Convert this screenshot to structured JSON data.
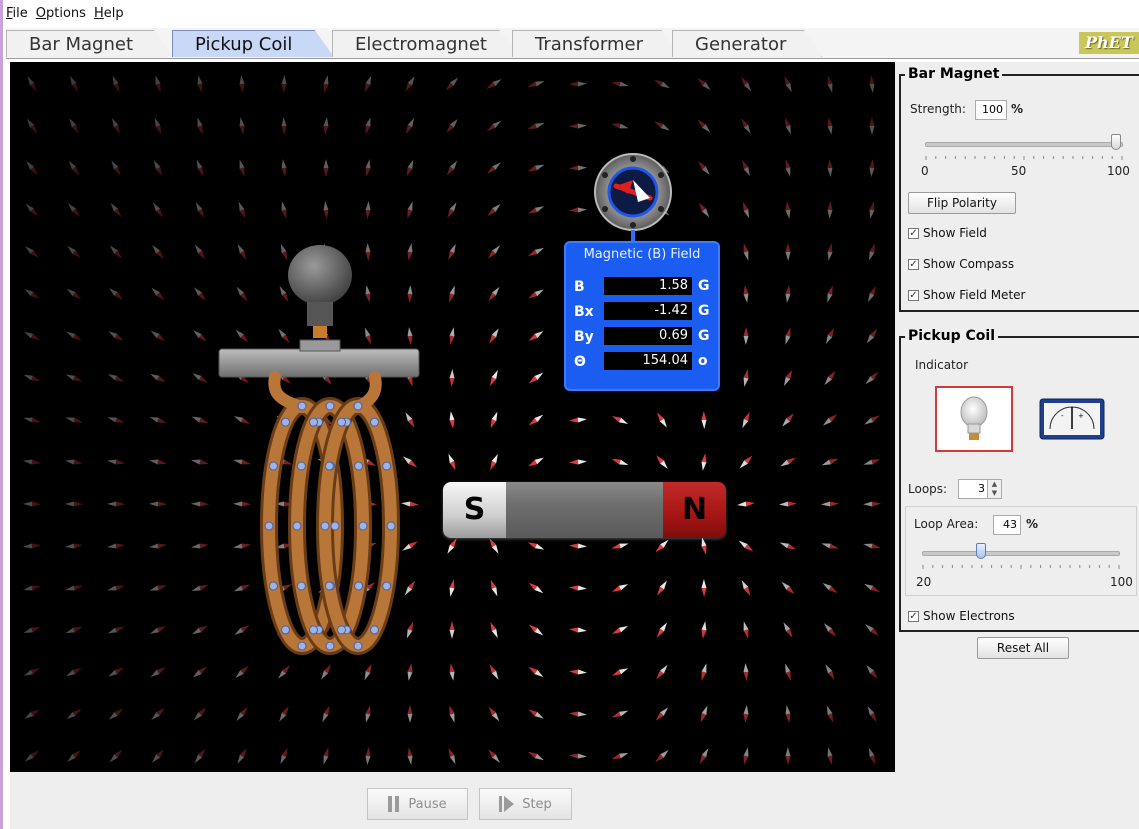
{
  "menu": [
    "File",
    "Options",
    "Help"
  ],
  "tabs": [
    {
      "label": "Bar Magnet",
      "active": false
    },
    {
      "label": "Pickup Coil",
      "active": true
    },
    {
      "label": "Electromagnet",
      "active": false
    },
    {
      "label": "Transformer",
      "active": false
    },
    {
      "label": "Generator",
      "active": false
    }
  ],
  "logo_text": "PhET",
  "field_meter": {
    "title": "Magnetic (B) Field",
    "rows": [
      {
        "label": "B",
        "value": "1.58",
        "unit": "G"
      },
      {
        "label": "Bx",
        "value": "-1.42",
        "unit": "G"
      },
      {
        "label": "By",
        "value": "0.69",
        "unit": "G"
      },
      {
        "label": "Θ",
        "value": "154.04",
        "unit": "o"
      }
    ]
  },
  "magnet": {
    "south_label": "S",
    "north_label": "N"
  },
  "controls": {
    "pause_label": "Pause",
    "step_label": "Step"
  },
  "panel": {
    "bar_magnet": {
      "title": "Bar Magnet",
      "strength_label": "Strength:",
      "strength_value": "100",
      "strength_unit": "%",
      "slider_min": "0",
      "slider_mid": "50",
      "slider_max": "100",
      "strength_fraction": 1.0,
      "flip_label": "Flip Polarity",
      "show_field": "Show Field",
      "show_compass": "Show Compass",
      "show_field_meter": "Show Field Meter"
    },
    "pickup_coil": {
      "title": "Pickup Coil",
      "indicator_label": "Indicator",
      "loops_label": "Loops:",
      "loops_value": "3",
      "loop_area_label": "Loop Area:",
      "loop_area_value": "43",
      "loop_area_unit": "%",
      "area_min": "20",
      "area_max": "100",
      "area_fraction": 0.29,
      "show_electrons": "Show Electrons"
    },
    "reset_label": "Reset All"
  },
  "colors": {
    "meter_blue": "#1b5df0",
    "magnet_north": "#b01c1c",
    "coil_copper": "#a8652c",
    "tab_active": "#c8d8f6"
  }
}
